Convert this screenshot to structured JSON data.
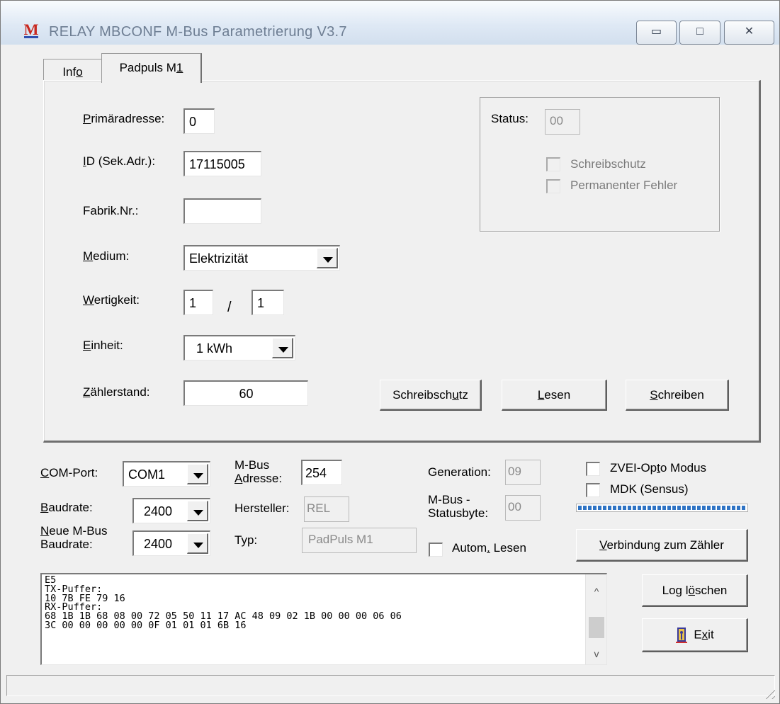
{
  "window": {
    "title": "RELAY MBCONF  M-Bus Parametrierung  V3.7",
    "minimize_glyph": "▭",
    "maximize_glyph": "□",
    "close_glyph": "✕",
    "app_icon_glyph": "M"
  },
  "tabs": {
    "info_pre": "Inf",
    "info_ul": "o",
    "info_post": "",
    "padpuls_pre": "Padpuls M",
    "padpuls_ul": "1",
    "padpuls_post": ""
  },
  "form": {
    "primary_address": {
      "label_ul": "P",
      "label_rest": "rimäradresse:",
      "value": "0"
    },
    "id": {
      "label_ul": "I",
      "label_rest": "D (Sek.Adr.):",
      "value": "17115005"
    },
    "fabrik": {
      "label": "Fabrik.Nr.:",
      "value": ""
    },
    "medium": {
      "label_ul": "M",
      "label_rest": "edium:",
      "selected": "Elektrizität"
    },
    "wertigkeit": {
      "label_ul": "W",
      "label_rest": "ertigkeit:",
      "value_a": "1",
      "separator": "/",
      "value_b": "1"
    },
    "einheit": {
      "label_ul": "E",
      "label_rest": "inheit:",
      "selected": "1 kWh"
    },
    "zaehlerstand": {
      "label_ul": "Z",
      "label_rest": "ählerstand:",
      "value": "60"
    }
  },
  "status_group": {
    "label": "Status:",
    "value": "00",
    "schreibschutz": "Schreibschutz",
    "permanenter_fehler": "Permanenter Fehler"
  },
  "actions": {
    "schreibschutz_pre": "Schreibsch",
    "schreibschutz_ul": "u",
    "schreibschutz_post": "tz",
    "lesen_ul": "L",
    "lesen_rest": "esen",
    "schreiben_ul": "S",
    "schreiben_rest": "chreiben"
  },
  "connection": {
    "com_port": {
      "label_ul": "C",
      "label_rest": "OM-Port:",
      "selected": "COM1"
    },
    "baudrate": {
      "label_ul": "B",
      "label_rest": "audrate:",
      "selected": "2400"
    },
    "neue_baudrate": {
      "label_line1_ul": "N",
      "label_line1_rest": "eue M-Bus",
      "label_line2": "Baudrate:",
      "selected": "2400"
    },
    "mbus_adresse": {
      "label_line1": "M-Bus",
      "label_line2_ul": "A",
      "label_line2_rest": "dresse:",
      "value": "254"
    },
    "hersteller": {
      "label": "Hersteller:",
      "value": "REL"
    },
    "typ": {
      "label": "Typ:",
      "value": "PadPuls M1"
    },
    "generation": {
      "label": "Generation:",
      "value": "09"
    },
    "statusbyte": {
      "label_line1": "M-Bus -",
      "label_line2": "Statusbyte:",
      "value": "00"
    },
    "autom_lesen": {
      "pre": "Autom",
      "ul": ".",
      "post": " Lesen"
    },
    "zvei": {
      "pre": "ZVEI-Op",
      "ul": "t",
      "post": "o Modus"
    },
    "mdk": "MDK (Sensus)",
    "progress_fraction": 1.0,
    "verbindung": {
      "ul": "V",
      "rest": "erbindung zum Zähler"
    }
  },
  "log": {
    "text": "E5\nTX-Puffer:\n10 7B FE 79 16\nRX-Puffer:\n68 1B 1B 68 08 00 72 05 50 11 17 AC 48 09 02 1B 00 00 00 06 06\n3C 00 00 00 00 00 0F 01 01 01 6B 16",
    "up_glyph": "^",
    "down_glyph": "v",
    "clear_pre": "Log l",
    "clear_ul": "ö",
    "clear_post": "schen",
    "exit_pre": "E",
    "exit_ul": "x",
    "exit_post": "it"
  },
  "colors": {
    "window_bg": "#f0f0f0",
    "title_text": "#6e7e93",
    "progress": "#2e73c4",
    "exit_icon": "#3a3a9a"
  }
}
